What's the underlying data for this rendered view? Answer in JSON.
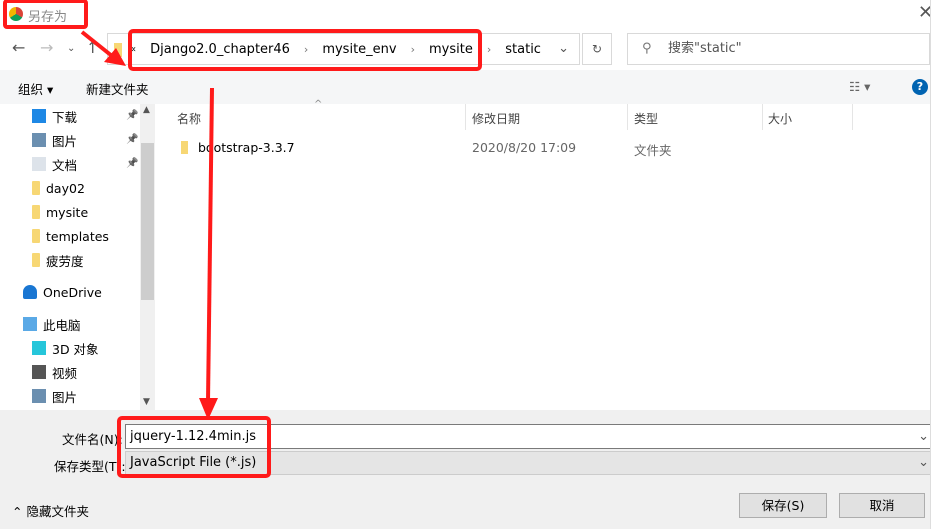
{
  "dialog": {
    "title": "另存为"
  },
  "address": {
    "overflow": "«",
    "crumbs": [
      "Django2.0_chapter46",
      "mysite_env",
      "mysite",
      "static"
    ]
  },
  "search": {
    "placeholder": "搜索\"static\""
  },
  "toolbar": {
    "organize": "组织 ▾",
    "new_folder": "新建文件夹"
  },
  "sidebar": {
    "items": [
      {
        "label": "下载",
        "icon": "download-icon",
        "pinned": true
      },
      {
        "label": "图片",
        "icon": "pictures-icon",
        "pinned": true
      },
      {
        "label": "文档",
        "icon": "documents-icon",
        "pinned": true
      },
      {
        "label": "day02",
        "icon": "folder-icon"
      },
      {
        "label": "mysite",
        "icon": "folder-icon"
      },
      {
        "label": "templates",
        "icon": "folder-icon"
      },
      {
        "label": "疲劳度",
        "icon": "folder-icon"
      },
      {
        "label": "OneDrive",
        "icon": "cloud-icon"
      },
      {
        "label": "此电脑",
        "icon": "computer-icon"
      },
      {
        "label": "3D 对象",
        "icon": "cube-icon"
      },
      {
        "label": "视频",
        "icon": "video-icon"
      },
      {
        "label": "图片",
        "icon": "pictures-icon"
      }
    ]
  },
  "columns": [
    "名称",
    "修改日期",
    "类型",
    "大小"
  ],
  "files": [
    {
      "name": "bootstrap-3.3.7",
      "modified": "2020/8/20 17:09",
      "type": "文件夹",
      "size": ""
    }
  ],
  "form": {
    "filename_label": "文件名(N):",
    "filename": "jquery-1.12.4min.js",
    "type_label": "保存类型(T):",
    "type": "JavaScript File (*.js)"
  },
  "buttons": {
    "hide_folders": "隐藏文件夹",
    "save": "保存(S)",
    "cancel": "取消"
  },
  "colors": {
    "annotation": "#ff1a1a",
    "accent": "#0063b1"
  }
}
